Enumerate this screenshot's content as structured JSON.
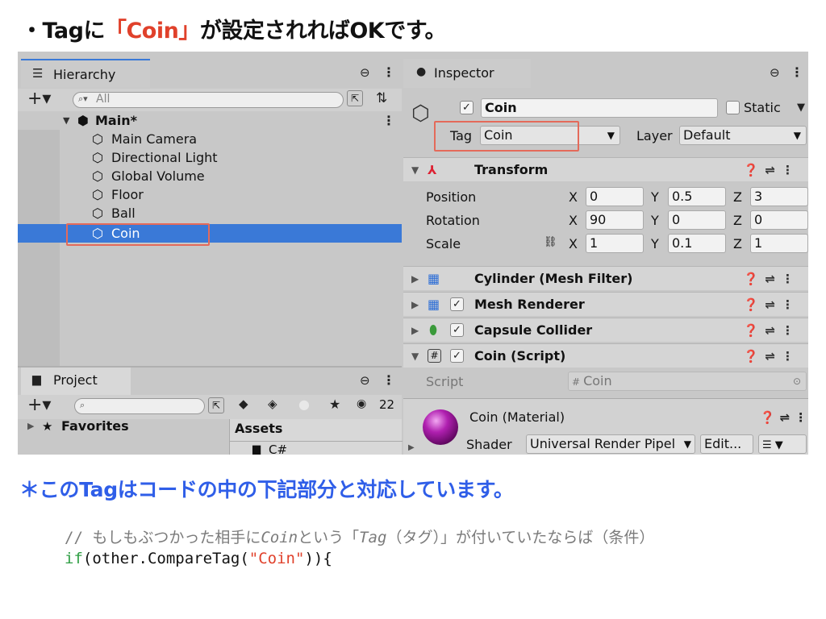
{
  "heading": {
    "prefix": "・Tagに",
    "highlight": "「Coin」",
    "suffix": "が設定されればOKです。"
  },
  "hierarchy": {
    "tab_label": "Hierarchy",
    "search_placeholder": "All",
    "scene_name": "Main*",
    "items": [
      "Main Camera",
      "Directional Light",
      "Global Volume",
      "Floor",
      "Ball",
      "Coin"
    ],
    "selected_item": "Coin"
  },
  "project": {
    "tab_label": "Project",
    "favorites_label": "Favorites",
    "assets_label": "Assets",
    "folder_partial": "C#",
    "hidden_count": "22"
  },
  "inspector": {
    "tab_label": "Inspector",
    "object_name": "Coin",
    "static_label": "Static",
    "tag_label": "Tag",
    "tag_value": "Coin",
    "layer_label": "Layer",
    "layer_value": "Default",
    "transform": {
      "title": "Transform",
      "position_label": "Position",
      "rotation_label": "Rotation",
      "scale_label": "Scale",
      "position": {
        "x": "0",
        "y": "0.5",
        "z": "3"
      },
      "rotation": {
        "x": "90",
        "y": "0",
        "z": "0"
      },
      "scale": {
        "x": "1",
        "y": "0.1",
        "z": "1"
      },
      "axis_x": "X",
      "axis_y": "Y",
      "axis_z": "Z"
    },
    "components": [
      "Cylinder (Mesh Filter)",
      "Mesh Renderer",
      "Capsule Collider",
      "Coin (Script)"
    ],
    "script_label": "Script",
    "script_value": "Coin",
    "material_name": "Coin (Material)",
    "shader_label": "Shader",
    "shader_value": "Universal Render Pipel",
    "edit_label": "Edit..."
  },
  "note": "＊このTagはコードの中の下記部分と対応しています。",
  "code": {
    "comment_a": "// もしもぶつかった相手に",
    "comment_b": "Coin",
    "comment_c": "という「",
    "comment_d": "Tag",
    "comment_e": "（タグ）」が付いていたならば（条件）",
    "kw_if": "if",
    "line2_a": "(other.CompareTag(",
    "line2_str": "\"Coin\"",
    "line2_b": ")){"
  },
  "colors": {
    "accent_red": "#e0412b",
    "note_blue": "#2f5ee8",
    "selection_blue": "#3a79d7",
    "keyword_green": "#2f9e44"
  }
}
